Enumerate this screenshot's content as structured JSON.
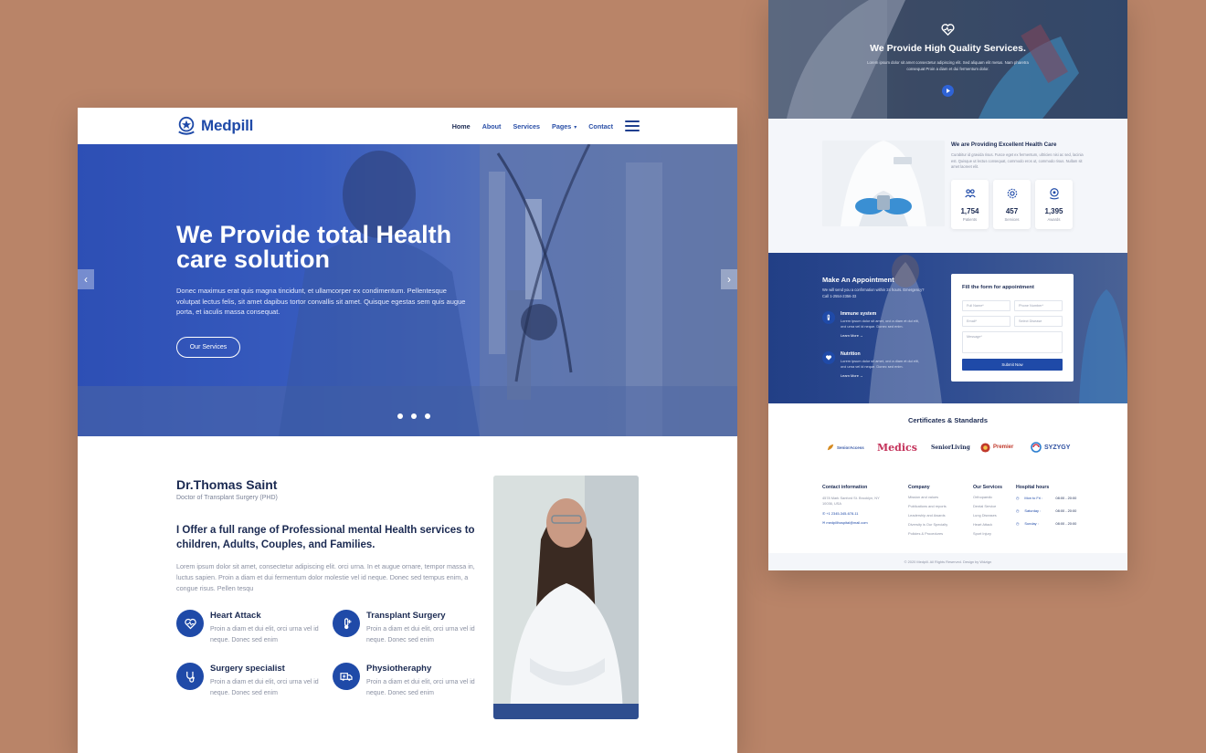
{
  "brand": {
    "name": "Medpill"
  },
  "nav": {
    "items": [
      {
        "label": "Home"
      },
      {
        "label": "About"
      },
      {
        "label": "Services"
      },
      {
        "label": "Pages"
      },
      {
        "label": "Contact"
      }
    ],
    "pages_caret": "▾"
  },
  "hero": {
    "title": "We Provide total Health care solution",
    "text": "Donec maximus erat quis magna tincidunt, et ullamcorper ex condimentum. Pellentesque volutpat lectus felis, sit amet dapibus tortor convallis sit amet. Quisque egestas sem quis augue porta, et iaculis massa consequat.",
    "button": "Our Services",
    "prev": "‹",
    "next": "›"
  },
  "doctor": {
    "name": "Dr.Thomas Saint",
    "role": "Doctor of Transplant Surgery (PHD)",
    "headline": "I Offer a full range of Professional mental Health services to children, Adults, Couples, and Families.",
    "text": "Lorem ipsum dolor sit amet, consectetur adipiscing elit. orci urna. In et augue ornare, tempor massa in, luctus sapien. Proin a diam et dui fermentum dolor molestie vel id neque. Donec sed tempus enim, a congue risus. Pellen tesqu",
    "services": [
      {
        "title": "Heart Attack",
        "desc": "Proin a diam et dui elit, orci urna vel id neque. Donec sed enim",
        "icon": "heart-pulse-icon"
      },
      {
        "title": "Transplant Surgery",
        "desc": "Proin a diam et dui elit, orci urna vel id neque. Donec sed enim",
        "icon": "thermometer-icon"
      },
      {
        "title": "Surgery specialist",
        "desc": "Proin a diam et dui elit, orci urna vel id neque. Donec sed enim",
        "icon": "stethoscope-icon"
      },
      {
        "title": "Physiotheraphy",
        "desc": "Proin a diam et dui elit, orci urna vel id neque. Donec sed enim",
        "icon": "ambulance-icon"
      }
    ]
  },
  "quality": {
    "title": "We Provide High Quality Services.",
    "text": "Lorem ipsum dolor sit amet consectetur adipiscing elit. Sed aliquam elit metus. Nam pharetra consequat Proin a diam et dui fermentum dolor."
  },
  "care": {
    "title": "We are Providing Excellent Health Care",
    "text": "Curabitur id gravida risus. Fusce eget ex fermentum, ultricies nisi ac sed, lacinia est. Quisque ut lectus consequat, commodo eros ut, commodo risus. Nullam sit amet laoreet elit.",
    "stats": [
      {
        "value": "1,754",
        "label": "Patients"
      },
      {
        "value": "457",
        "label": "Services"
      },
      {
        "value": "1,395",
        "label": "Awards"
      }
    ]
  },
  "appointment": {
    "title": "Make An Appointment",
    "text": "We will send you a confirmation within 24 hours. Emergency? Call 1-2554-2356-33",
    "features": [
      {
        "title": "Immune system",
        "desc": "Lorem ipsum dolor sit amet, orci a diam et dui elit, orci urna vel id neque. Donec sed enim.",
        "link": "Learn More →"
      },
      {
        "title": "Nutrition",
        "desc": "Lorem ipsum dolor sit amet, orci a diam et dui elit, orci urna vel id neque. Donec sed enim.",
        "link": "Learn More →"
      }
    ],
    "form": {
      "title": "Fill the form for appointment",
      "full_name": "Full Name*",
      "phone": "Phone Number*",
      "email": "Email*",
      "disease": "Select Disease",
      "message": "Message*",
      "submit": "Submit Now"
    }
  },
  "certificates": {
    "title": "Certificates & Standards",
    "logos": [
      "SeniorAccess",
      "Medics",
      "SeniorLiving",
      "Premier",
      "SYZYGY"
    ]
  },
  "footer": {
    "contact": {
      "title": "Contact information",
      "address": "4578 Mark Sanford St. Brooklyn, NY 10036, USA",
      "phone": "+1 2345-345-678-11",
      "email": "medpillhospital@mail.com"
    },
    "company": {
      "title": "Company",
      "items": [
        "Mission and values",
        "Publications and reports",
        "Leadership and Awards",
        "Diversity is Our Specialty",
        "Policies & Procedures"
      ]
    },
    "services": {
      "title": "Our Services",
      "items": [
        "Orthopaedic",
        "Dental Service",
        "Lung Diseases",
        "Heart Attack",
        "Sport Injury"
      ]
    },
    "hours": {
      "title": "Hospital hours",
      "rows": [
        {
          "day": "Mon to Fri :",
          "time": "08:00 - 20:00"
        },
        {
          "day": "Saturday :",
          "time": "08:00 - 20:00"
        },
        {
          "day": "Sunday :",
          "time": "08:00 - 20:00"
        }
      ]
    },
    "copyright": "© 2020 Medpill. All Rights Reserved. Design by Wdzign"
  }
}
